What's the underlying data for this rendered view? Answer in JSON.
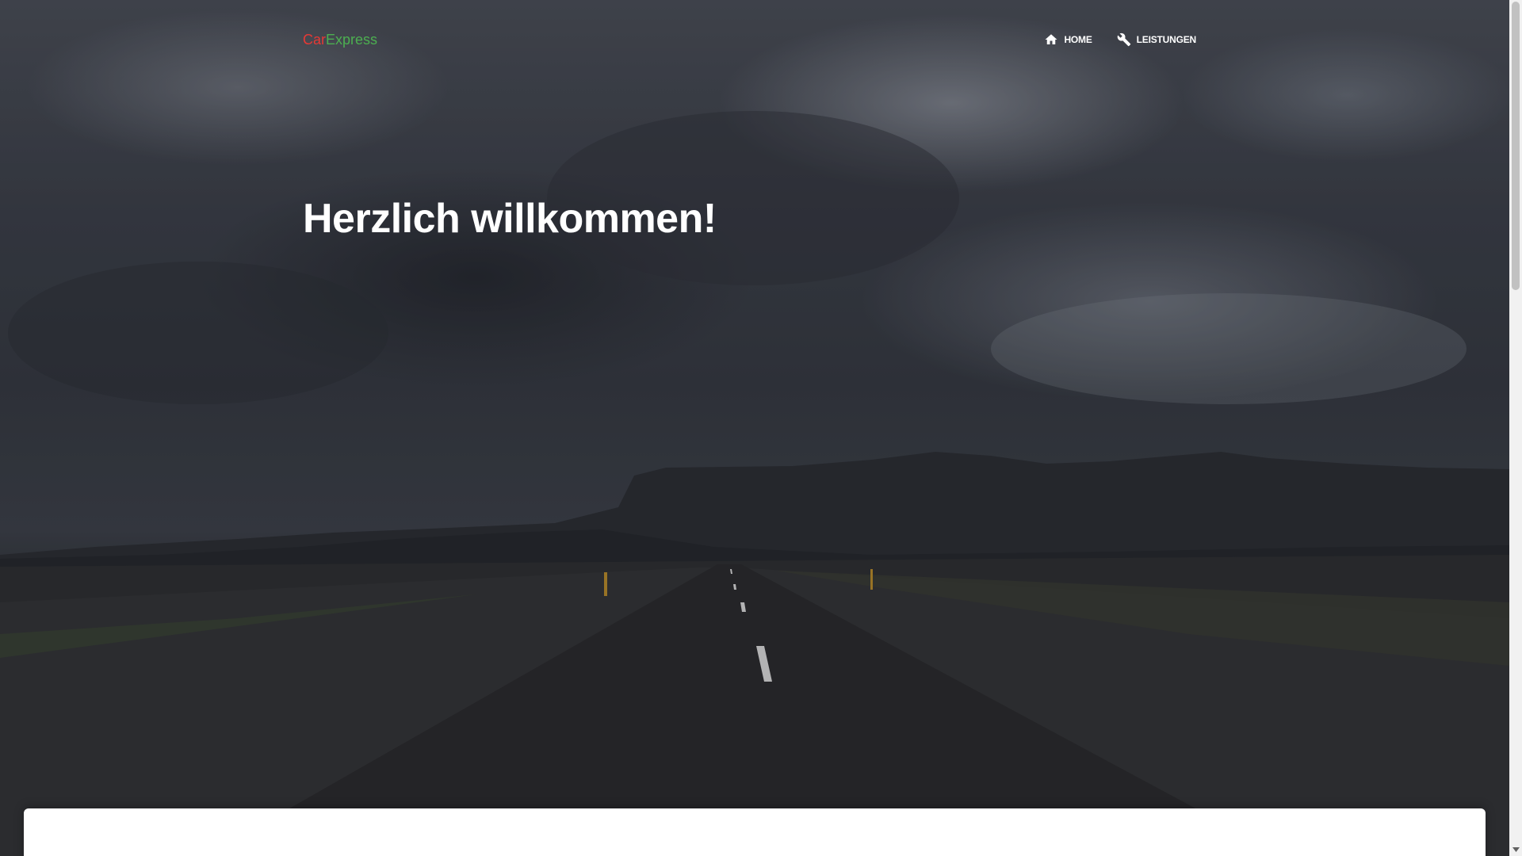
{
  "brand": {
    "part1": "Car",
    "part2": "Express",
    "part1_color": "#e53935",
    "part2_color": "#4caf50"
  },
  "nav": {
    "items": [
      {
        "label": "HOME",
        "icon": "home-icon"
      },
      {
        "label": "LEISTUNGEN",
        "icon": "wrench-icon"
      }
    ]
  },
  "hero": {
    "headline": "Herzlich willkommen!",
    "background": "stormy sky over road and mountains photo"
  },
  "colors": {
    "text_on_hero": "#ffffff",
    "card_background": "#ffffff"
  }
}
